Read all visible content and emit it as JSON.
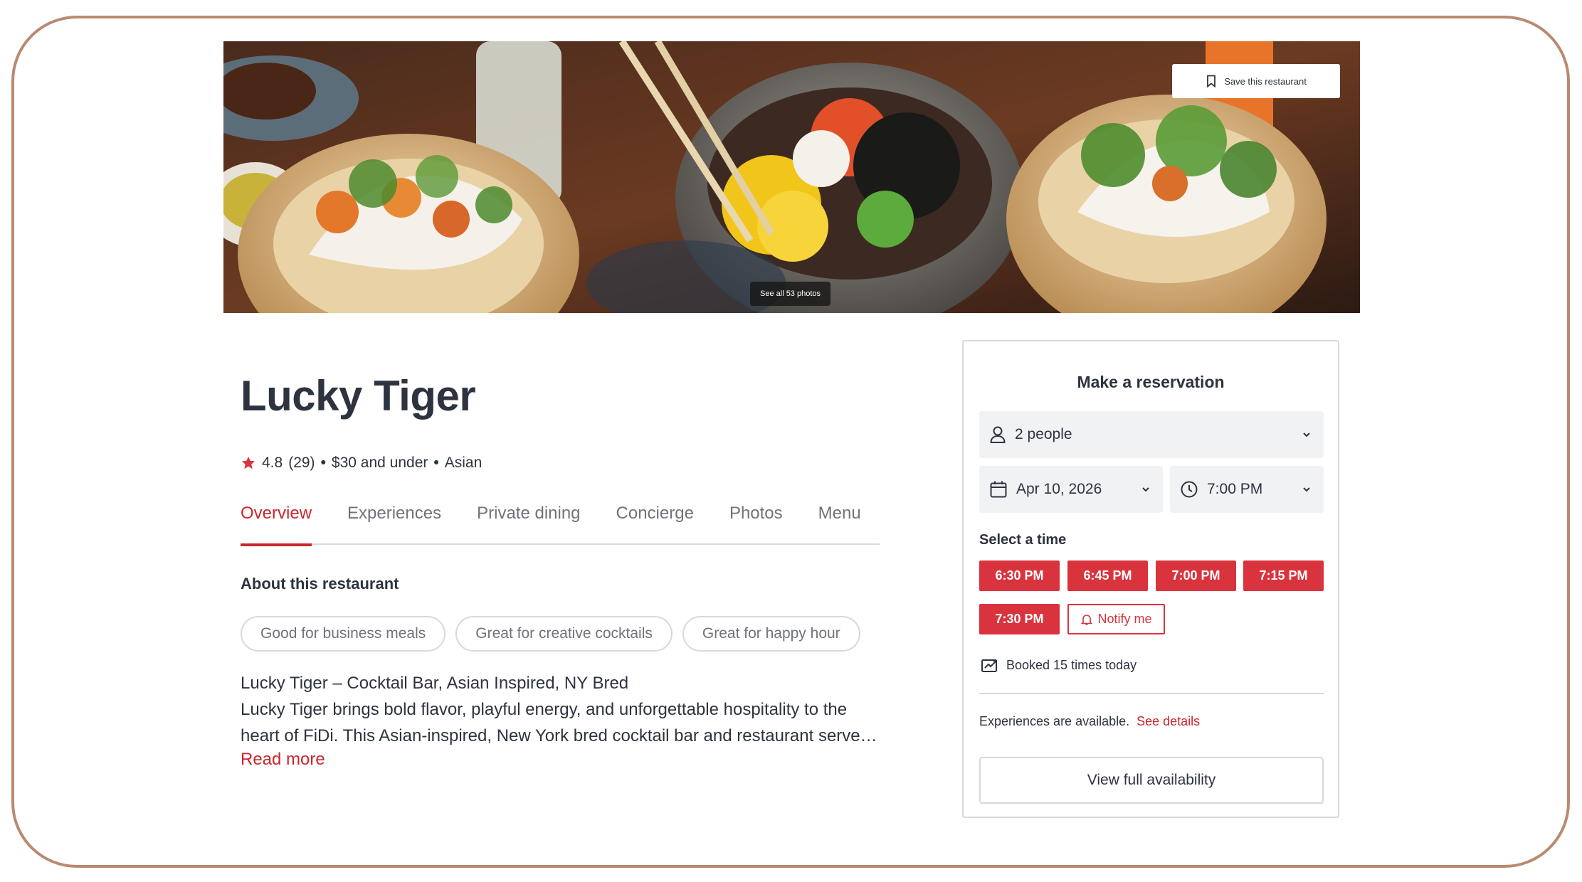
{
  "hero": {
    "save_label": "Save this restaurant",
    "see_photos_label": "See all 53 photos"
  },
  "restaurant": {
    "name": "Lucky Tiger",
    "rating": "4.8",
    "review_count": "(29)",
    "price": "$30 and under",
    "cuisine": "Asian",
    "separator": "•"
  },
  "tabs": [
    {
      "label": "Overview",
      "active": true
    },
    {
      "label": "Experiences"
    },
    {
      "label": "Private dining"
    },
    {
      "label": "Concierge"
    },
    {
      "label": "Photos"
    },
    {
      "label": "Menu"
    }
  ],
  "about": {
    "heading": "About this restaurant",
    "tags": [
      "Good for business meals",
      "Great for creative cocktails",
      "Great for happy hour"
    ],
    "lines": [
      "Lucky Tiger – Cocktail Bar, Asian Inspired, NY Bred",
      "Lucky Tiger brings bold flavor, playful energy, and unforgettable hospitality to the",
      "heart of FiDi. This Asian-inspired, New York bred cocktail bar and restaurant serve…"
    ],
    "read_more": "Read more"
  },
  "reservation": {
    "title": "Make a reservation",
    "party_size": "2 people",
    "date": "Apr 10, 2026",
    "time": "7:00 PM",
    "select_time_label": "Select a time",
    "slots": [
      "6:30 PM",
      "6:45 PM",
      "7:00 PM",
      "7:15 PM",
      "7:30 PM"
    ],
    "notify_label": "Notify me",
    "booked_text": "Booked 15 times today",
    "experiences_text": "Experiences are available.",
    "see_details": "See details",
    "full_availability": "View full availability"
  },
  "colors": {
    "brand_red": "#c8272d",
    "slot_red": "#d9343e",
    "frame": "#b98a72",
    "text": "#2d333f",
    "muted": "#6f737b"
  }
}
